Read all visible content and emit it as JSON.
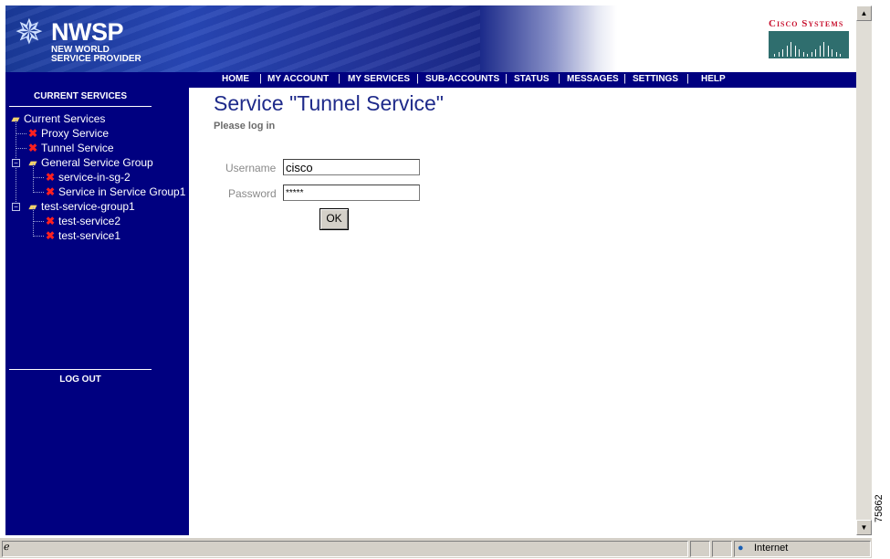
{
  "header": {
    "logo_main": "NWSP",
    "logo_sub_1": "NEW WORLD",
    "logo_sub_2": "SERVICE PROVIDER",
    "cisco": "Cisco Systems"
  },
  "nav": {
    "items": [
      "HOME",
      "MY ACCOUNT",
      "MY SERVICES",
      "SUB-ACCOUNTS",
      "STATUS",
      "MESSAGES",
      "SETTINGS",
      "HELP"
    ]
  },
  "sidebar": {
    "heading": "CURRENT SERVICES",
    "logout": "LOG OUT",
    "tree": [
      {
        "label": "Current Services",
        "icon": "folder-icon"
      },
      {
        "label": "Proxy Service",
        "icon": "x-icon"
      },
      {
        "label": "Tunnel Service",
        "icon": "x-icon"
      },
      {
        "label": "General Service Group",
        "icon": "folder-icon"
      },
      {
        "label": "service-in-sg-2",
        "icon": "x-icon"
      },
      {
        "label": "Service in Service Group1",
        "icon": "x-icon"
      },
      {
        "label": "test-service-group1",
        "icon": "folder-icon"
      },
      {
        "label": "test-service2",
        "icon": "x-icon"
      },
      {
        "label": "test-service1",
        "icon": "x-icon"
      }
    ]
  },
  "main": {
    "title": "Service \"Tunnel Service\"",
    "subtitle": "Please log in",
    "username_label": "Username",
    "username_value": "cisco",
    "password_label": "Password",
    "password_value": "*****",
    "ok_label": "OK"
  },
  "statusbar": {
    "zone": "Internet",
    "figure_number": "75862"
  },
  "colors": {
    "nav_bg": "#000080",
    "title": "#1e2a8a",
    "cisco_red": "#c8102e"
  }
}
